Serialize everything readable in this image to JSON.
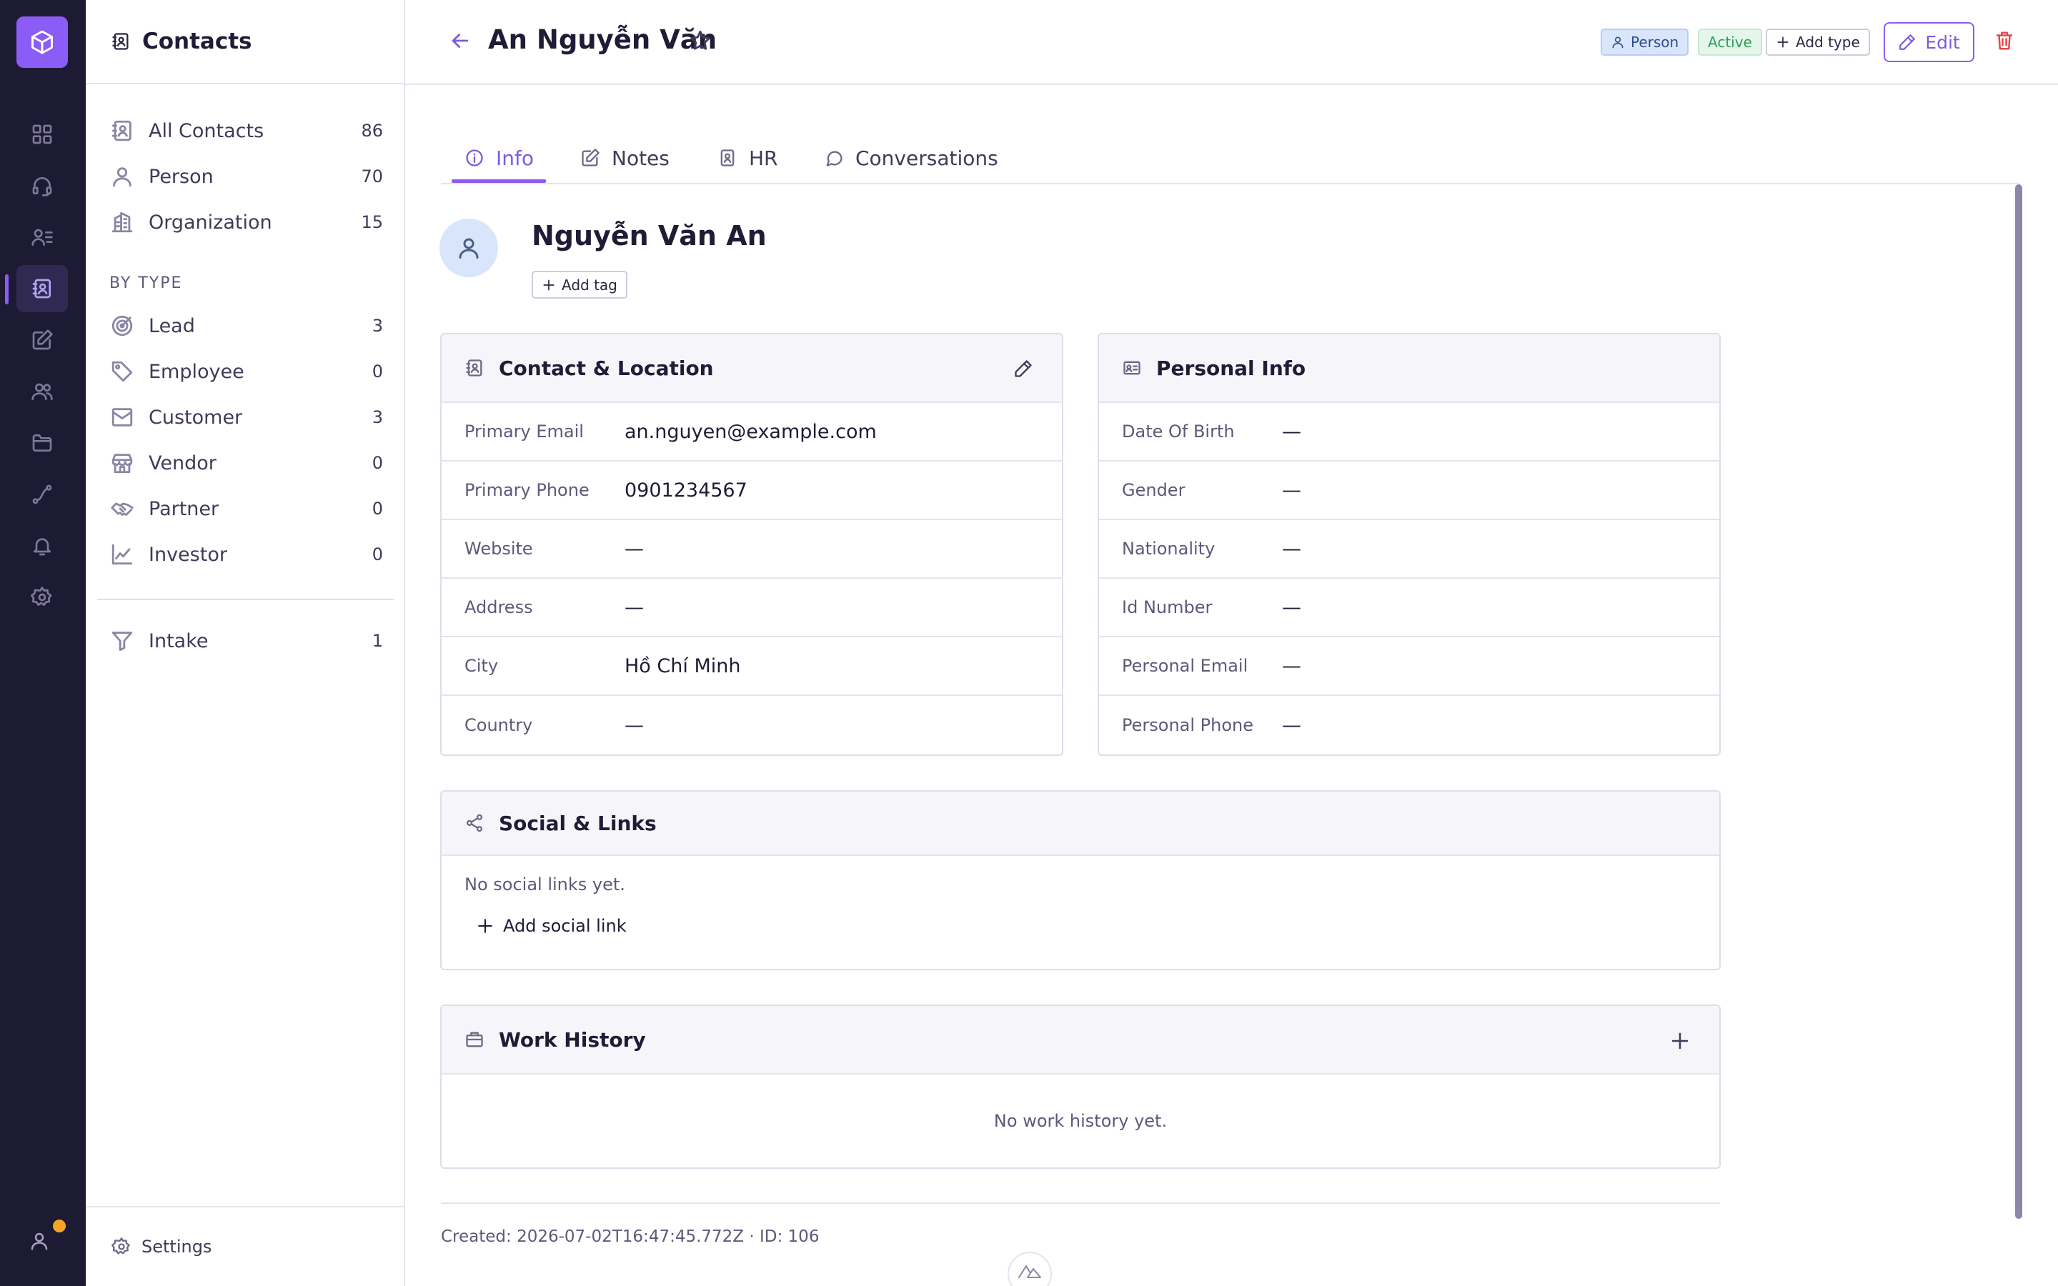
{
  "rail": {
    "items": [
      {
        "icon": "dashboard-icon"
      },
      {
        "icon": "headset-icon"
      },
      {
        "icon": "user-list-icon"
      },
      {
        "icon": "contacts-icon",
        "active": true
      },
      {
        "icon": "edit-icon"
      },
      {
        "icon": "users-icon"
      },
      {
        "icon": "folder-icon"
      },
      {
        "icon": "route-icon"
      },
      {
        "icon": "bell-icon"
      },
      {
        "icon": "gear-icon"
      }
    ],
    "user_icon": "user-icon",
    "status_dot_color": "#f5a524"
  },
  "sidebar": {
    "title": "Contacts",
    "items": [
      {
        "label": "All Contacts",
        "count": "86",
        "icon": "contacts-icon"
      },
      {
        "label": "Person",
        "count": "70",
        "icon": "person-icon"
      },
      {
        "label": "Organization",
        "count": "15",
        "icon": "building-icon"
      }
    ],
    "section_title": "BY TYPE",
    "type_items": [
      {
        "label": "Lead",
        "count": "3",
        "icon": "target-icon"
      },
      {
        "label": "Employee",
        "count": "0",
        "icon": "tag-icon"
      },
      {
        "label": "Customer",
        "count": "3",
        "icon": "inbox-icon"
      },
      {
        "label": "Vendor",
        "count": "0",
        "icon": "store-icon"
      },
      {
        "label": "Partner",
        "count": "0",
        "icon": "handshake-icon"
      },
      {
        "label": "Investor",
        "count": "0",
        "icon": "chart-line-icon"
      }
    ],
    "intake": {
      "label": "Intake",
      "count": "1",
      "icon": "filter-icon"
    },
    "settings_label": "Settings"
  },
  "header": {
    "title": "An Nguyễn Văn",
    "badges": {
      "person": "Person",
      "active": "Active",
      "add_type": "Add type"
    },
    "edit_label": "Edit"
  },
  "tabs": [
    {
      "label": "Info",
      "active": true
    },
    {
      "label": "Notes"
    },
    {
      "label": "HR"
    },
    {
      "label": "Conversations"
    }
  ],
  "profile": {
    "name": "Nguyễn Văn An",
    "add_tag_label": "Add tag"
  },
  "contact_location": {
    "title": "Contact & Location",
    "rows": [
      {
        "label": "Primary Email",
        "value": "an.nguyen@example.com"
      },
      {
        "label": "Primary Phone",
        "value": "0901234567"
      },
      {
        "label": "Website",
        "value": "—"
      },
      {
        "label": "Address",
        "value": "—"
      },
      {
        "label": "City",
        "value": "Hồ Chí Minh"
      },
      {
        "label": "Country",
        "value": "—"
      }
    ]
  },
  "personal_info": {
    "title": "Personal Info",
    "rows": [
      {
        "label": "Date Of Birth",
        "value": "—"
      },
      {
        "label": "Gender",
        "value": "—"
      },
      {
        "label": "Nationality",
        "value": "—"
      },
      {
        "label": "Id Number",
        "value": "—"
      },
      {
        "label": "Personal Email",
        "value": "—"
      },
      {
        "label": "Personal Phone",
        "value": "—"
      }
    ]
  },
  "social": {
    "title": "Social & Links",
    "empty": "No social links yet.",
    "add_label": "Add social link"
  },
  "work_history": {
    "title": "Work History",
    "empty": "No work history yet."
  },
  "footer": {
    "meta": "Created: 2026-07-02T16:47:45.772Z · ID: 106"
  },
  "colors": {
    "rail_bg": "#1d1a33",
    "accent": "#8b5cf6",
    "active_green": "#2f9e58",
    "person_blue": "#2c4f8f",
    "danger": "#e5484d"
  }
}
